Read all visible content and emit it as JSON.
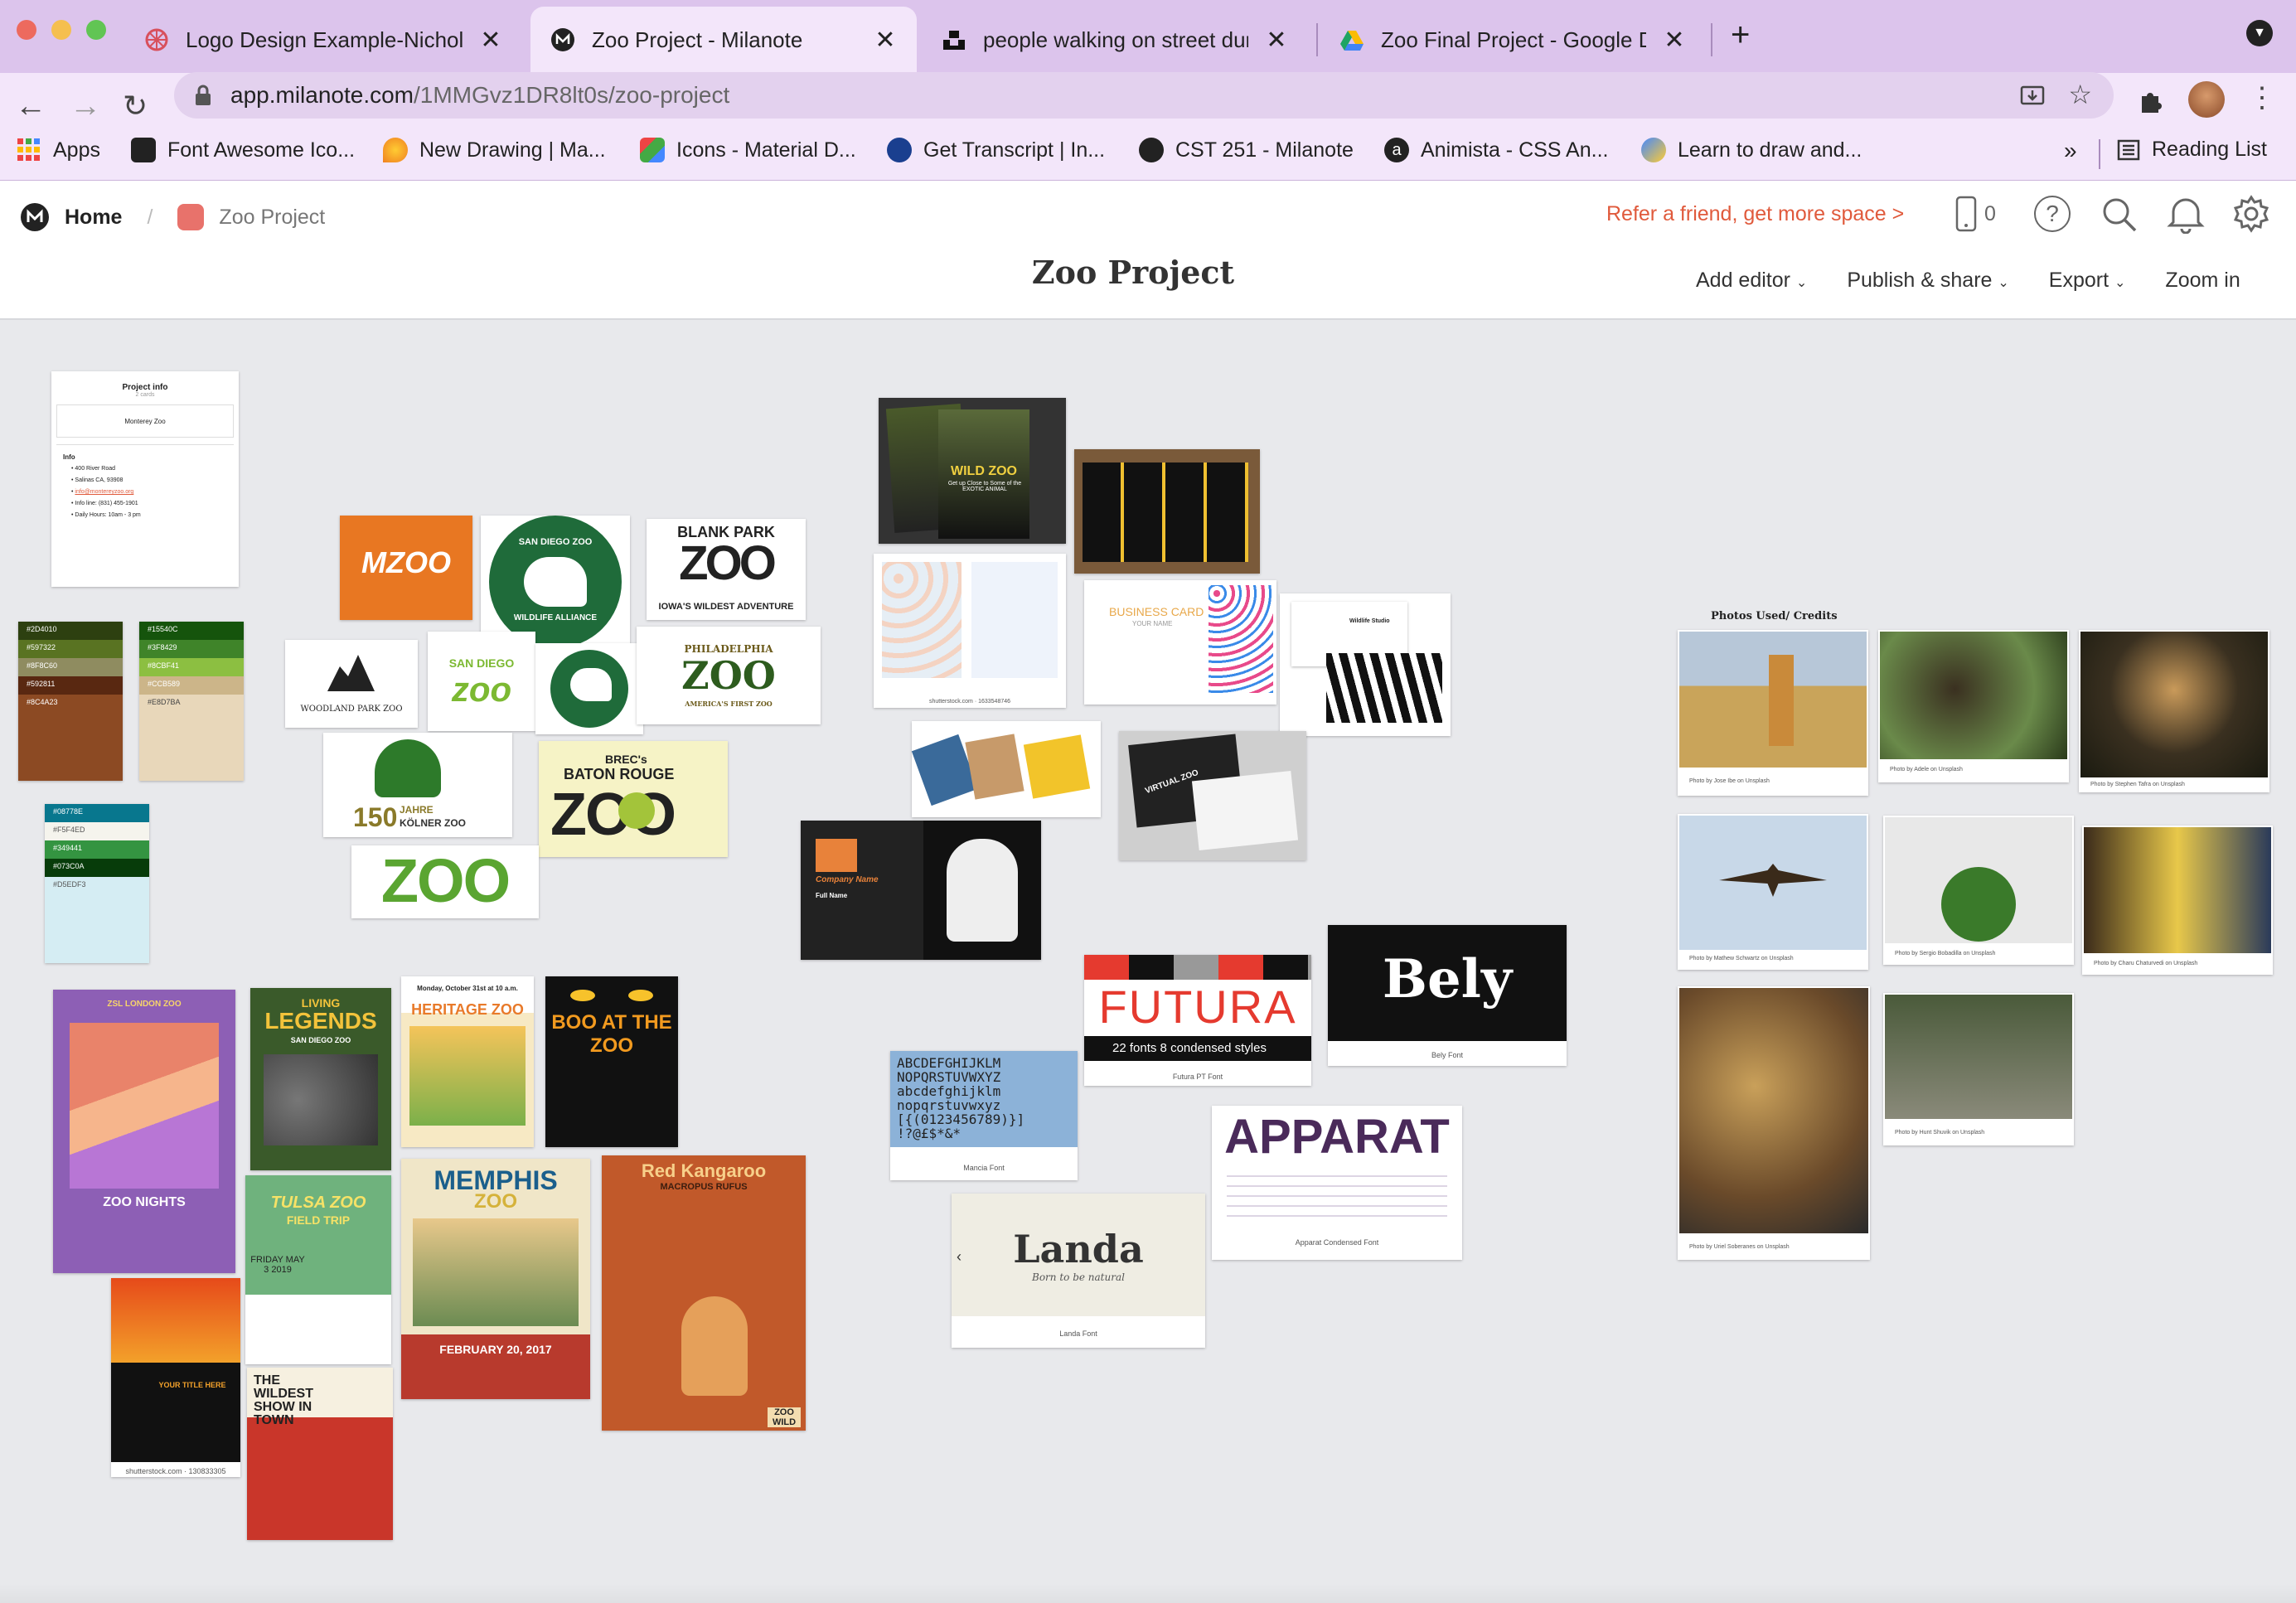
{
  "browser": {
    "tabs": [
      {
        "title": "Logo Design Example-Nicholas",
        "active": false,
        "icon": "pinwheel-icon"
      },
      {
        "title": "Zoo Project - Milanote",
        "active": true,
        "icon": "milanote-icon"
      },
      {
        "title": "people walking on street during",
        "active": false,
        "icon": "unsplash-icon"
      },
      {
        "title": "Zoo Final Project - Google Driv",
        "active": false,
        "icon": "google-drive-icon"
      }
    ],
    "url_host": "app.milanote.com",
    "url_path": "/1MMGvz1DR8lt0s/zoo-project",
    "bookmarks": [
      {
        "label": "Apps"
      },
      {
        "label": "Font Awesome Ico..."
      },
      {
        "label": "New Drawing | Ma..."
      },
      {
        "label": "Icons - Material D..."
      },
      {
        "label": "Get Transcript | In..."
      },
      {
        "label": "CST 251 - Milanote"
      },
      {
        "label": "Animista - CSS An..."
      },
      {
        "label": "Learn to draw and..."
      }
    ],
    "more": "»",
    "reading_list": "Reading List",
    "colors": {
      "tabbar": "#dcc4ec",
      "toolbar": "#f3e6fa"
    }
  },
  "app": {
    "breadcrumb_home": "Home",
    "breadcrumb_sep": "/",
    "breadcrumb_board": "Zoo Project",
    "refer": "Refer a friend, get more space >",
    "device_count": "0",
    "board_title": "Zoo Project",
    "menu": {
      "add_editor": "Add editor",
      "publish": "Publish & share",
      "export": "Export",
      "zoom": "Zoom in"
    },
    "accent": "#e05a3c"
  },
  "board": {
    "project_info": {
      "title": "Project info",
      "subtitle": "2 cards",
      "name": "Monterey Zoo",
      "info_heading": "Info",
      "items": [
        "400 River Road",
        "Salinas CA, 93908",
        "info@montereyzoo.org",
        "Info line: (831) 455-1901",
        "Daily Hours: 10am - 3 pm"
      ]
    },
    "palettes": [
      [
        "#2D4010",
        "#597322",
        "#8F8C60",
        "#592811",
        "#8C4A23"
      ],
      [
        "#15540C",
        "#3F8429",
        "#8CBF41",
        "#CCB589",
        "#E8D7BA"
      ],
      [
        "#08778E",
        "#F5F4ED",
        "#349441",
        "#073C0A",
        "#D5EDF3"
      ]
    ],
    "logos": {
      "mzoo": "MZOO",
      "san_diego_ring": "SAN DIEGO ZOO",
      "san_diego_bottom": "WILDLIFE ALLIANCE",
      "blank_park_top": "BLANK PARK",
      "blank_park_zoo": "ZOO",
      "blank_park_bottom": "IOWA'S WILDEST ADVENTURE",
      "woodland": "WOODLAND PARK ZOO",
      "sd_small": "SAN DIEGO",
      "sd_zoo": "zoo",
      "philly_top": "PHILADELPHIA",
      "philly_zoo": "ZOO",
      "philly_bottom": "AMERICA'S FIRST ZOO",
      "koln_150": "150",
      "koln_jahre": "JAHRE",
      "koln_name": "KÖLNER ZOO",
      "brec": "BREC's",
      "baton_rouge": "BATON ROUGE",
      "br_zoo": "ZOO",
      "zoo_green": "ZOO"
    },
    "posters": {
      "london": "ZSL LONDON ZOO",
      "zoo_nights": "ZOO NIGHTS",
      "legends_living": "LIVING",
      "legends": "LEGENDS",
      "legends_sub": "SAN DIEGO ZOO",
      "heritage": "HERITAGE ZOO",
      "heritage_date": "Monday, October 31st at 10 a.m.",
      "boo": "BOO AT THE ZOO",
      "tulsa": "TULSA ZOO",
      "tulsa_sub": "FIELD TRIP",
      "tulsa_date": "FRIDAY MAY 3 2019",
      "memphis": "MEMPHIS",
      "memphis_zoo": "ZOO",
      "memphis_date": "FEBRUARY 20, 2017",
      "red_kangaroo": "Red Kangaroo",
      "red_kangaroo_sub": "MACROPUS RUFUS",
      "kangaroo_corner": "ZOO WILD",
      "sunset_title": "YOUR TITLE HERE",
      "sunset_caption": "shutterstock.com · 130833305",
      "wildest_show": "THE WILDEST SHOW IN TOWN"
    },
    "cards": {
      "wild_zoo": "WILD ZOO",
      "wild_zoo_sub": "Get up Close to Some of the EXOTIC ANIMAL",
      "shutter_caption": "shutterstock.com · 1633548746",
      "business": "BUSINESS CARD",
      "your_name": "YOUR NAME",
      "company_name": "Company Name",
      "full_name": "Full Name",
      "virtual_zoo": "VIRTUAL ZOO",
      "wildlife": "Wildlife Studio"
    },
    "fonts": {
      "futura": "FUTURA",
      "futura_sub": "22 fonts 8 condensed styles",
      "futura_caption": "Futura PT Font",
      "bely": "Bely",
      "bely_caption": "Bely Font",
      "mancia_lines": [
        "ABCDEFGHIJKLM",
        "NOPQRSTUVWXYZ",
        "abcdefghijklm",
        "nopqrstuvwxyz",
        "[{(0123456789)}]",
        "!?@£$*&*"
      ],
      "mancia_caption": "Mancia Font",
      "apparat": "APPARAT",
      "apparat_caption": "Apparat Condensed Font",
      "landa": "Landa",
      "landa_sub": "Born to be natural",
      "landa_caption": "Landa Font"
    },
    "photos": {
      "heading": "Photos Used/ Credits",
      "credits": [
        "Photo by Jose Ibe on Unsplash",
        "Photo by Adele on Unsplash",
        "Photo by Stephen Tafra on Unsplash",
        "Photo by Mathew Schwartz on Unsplash",
        "Photo by Sergio Bobadilla on Unsplash",
        "Photo by Charu Chaturvedi on Unsplash",
        "Photo by Uriel Soberanes on Unsplash",
        "Photo by Hunt Shuvik on Unsplash"
      ]
    }
  }
}
